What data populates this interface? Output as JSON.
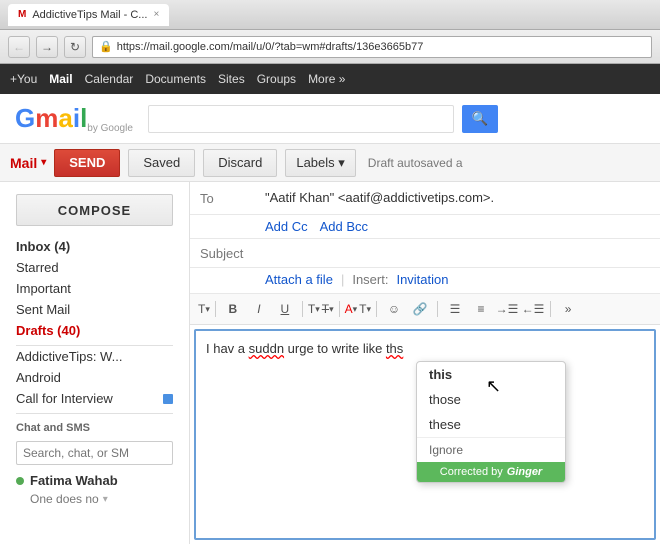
{
  "browser": {
    "tab_title": "AddictiveTips Mail - C...",
    "tab_icon": "M",
    "address": "https://mail.google.com/mail/u/0/?tab=wm#drafts/136e3665b77",
    "close_label": "×"
  },
  "topbar": {
    "plus_you": "+You",
    "mail": "Mail",
    "calendar": "Calendar",
    "documents": "Documents",
    "sites": "Sites",
    "groups": "Groups",
    "more": "More »"
  },
  "header": {
    "logo": "Gmail",
    "search_placeholder": "",
    "search_btn_icon": "🔍"
  },
  "action_bar": {
    "mail_label": "Mail",
    "send_label": "SEND",
    "saved_label": "Saved",
    "discard_label": "Discard",
    "labels_label": "Labels ▾",
    "draft_status": "Draft autosaved a"
  },
  "sidebar": {
    "compose_label": "COMPOSE",
    "items": [
      {
        "label": "Inbox (4)",
        "bold": true
      },
      {
        "label": "Starred",
        "bold": false
      },
      {
        "label": "Important",
        "bold": false
      },
      {
        "label": "Sent Mail",
        "bold": false
      },
      {
        "label": "Drafts (40)",
        "bold": true,
        "red": true
      }
    ],
    "more_items": [
      {
        "label": "AddictiveTips: W..."
      },
      {
        "label": "Android"
      },
      {
        "label": "Call for Interview"
      }
    ],
    "chat_section": "Chat and SMS",
    "chat_search_placeholder": "Search, chat, or SM",
    "chat_user": {
      "name": "Fatima Wahab",
      "message": "One does no",
      "status": "online"
    }
  },
  "compose": {
    "to_label": "To",
    "to_value": "\"Aatif Khan\" <aatif@addictivetips.com>.",
    "add_cc": "Add Cc",
    "add_bcc": "Add Bcc",
    "subject_label": "Subject",
    "subject_value": "",
    "attach_label": "Attach a file",
    "insert_label": "Insert:",
    "invitation_label": "Invitation",
    "body_text": "I hav a suddn urge to write like ths",
    "formatting": {
      "buttons": [
        "T▾",
        "B",
        "I",
        "U",
        "T▾",
        "T̶▾",
        "A▾",
        "T▾",
        "☺",
        "🔗",
        "≡",
        "≡",
        "≡",
        "≡",
        "»"
      ]
    }
  },
  "autocorrect": {
    "suggestions": [
      "this",
      "those",
      "these"
    ],
    "ignore_label": "Ignore",
    "corrected_by": "Corrected by",
    "brand": "Ginger"
  }
}
